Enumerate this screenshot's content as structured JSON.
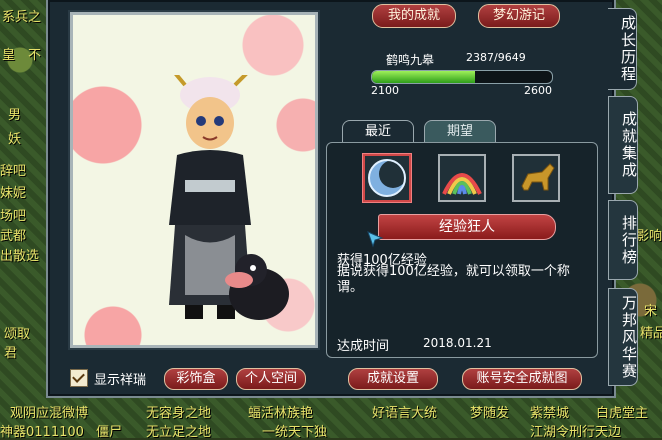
{
  "world_chat": [
    {
      "text": "系兵之",
      "x": "",
      "color": "#e8e26a"
    },
    {
      "text": "皇　不",
      "color": "#e8e26a"
    },
    {
      "text": "男",
      "color": "#f0e060"
    },
    {
      "text": "妖",
      "color": "#f0e060"
    },
    {
      "text": "辞吧",
      "color": "#f0e060"
    },
    {
      "text": "妹妮",
      "color": "#f0e060"
    },
    {
      "text": "场吧",
      "color": "#f0e060"
    },
    {
      "text": "武都",
      "color": "#f0e060"
    },
    {
      "text": "出散选",
      "color": "#f0e060"
    },
    {
      "text": "颂取",
      "color": "#f0e060"
    },
    {
      "text": "君",
      "color": "#f0e060"
    },
    {
      "text": "观阴应混微博",
      "color": "#e8e26a"
    },
    {
      "text": "无容身之地",
      "color": "#e8e26a"
    },
    {
      "text": "蝠活林族艳",
      "color": "#e8e26a"
    },
    {
      "text": "好语言大统",
      "color": "#e8e26a"
    },
    {
      "text": "梦随发",
      "color": "#e8e26a"
    },
    {
      "text": "紫禁城",
      "color": "#e8e26a"
    },
    {
      "text": "白虎堂主",
      "color": "#e8e26a"
    },
    {
      "text": "神器0111100",
      "color": "#e8e26a"
    },
    {
      "text": "僵尸",
      "color": "#e8e26a"
    },
    {
      "text": "无立足之地",
      "color": "#e8e26a"
    },
    {
      "text": "一统天下独",
      "color": "#e8e26a"
    },
    {
      "text": "江湖令刑行天边",
      "color": "#e8e26a"
    },
    {
      "text": "影响",
      "color": "#f0e060"
    },
    {
      "text": "宋",
      "color": "#f0e060"
    },
    {
      "text": "精品",
      "color": "#f0e060"
    }
  ],
  "header": {
    "my_achievements": "我的成就",
    "fantasy_journey": "梦幻游记"
  },
  "progress": {
    "rank_name": "鹤鸣九皋",
    "value_text": "2387/9649",
    "range_min": "2100",
    "range_max": "2600",
    "fraction": 0.574
  },
  "tabs": [
    {
      "label": "最近",
      "active": true
    },
    {
      "label": "期望",
      "active": false
    }
  ],
  "achievement_icons": [
    {
      "name": "moon-orb-icon",
      "selected": true
    },
    {
      "name": "rainbow-icon",
      "selected": false
    },
    {
      "name": "golden-horse-icon",
      "selected": false
    }
  ],
  "achievement": {
    "banner": "经验狂人",
    "title": "获得100亿经验",
    "description": "据说获得100亿经验，就可以领取一个称谓。",
    "time_label": "达成时间",
    "time_value": "2018.01.21"
  },
  "bottom": {
    "show_details": "显示祥瑞",
    "show_details_checked": true,
    "costume_box": "彩饰盒",
    "personal_space": "个人空间",
    "achievement_settings": "成就设置",
    "account_security": "账号安全成就图"
  },
  "side_tabs": [
    {
      "label": "成长历程",
      "active": true
    },
    {
      "label": "成就集成",
      "active": false
    },
    {
      "label": "排行榜",
      "active": false
    },
    {
      "label": "万邦风华赛",
      "active": false
    }
  ],
  "colors": {
    "button_red": "#a83232",
    "progress_green": "#5fd03a",
    "selected_border": "#d04848"
  }
}
